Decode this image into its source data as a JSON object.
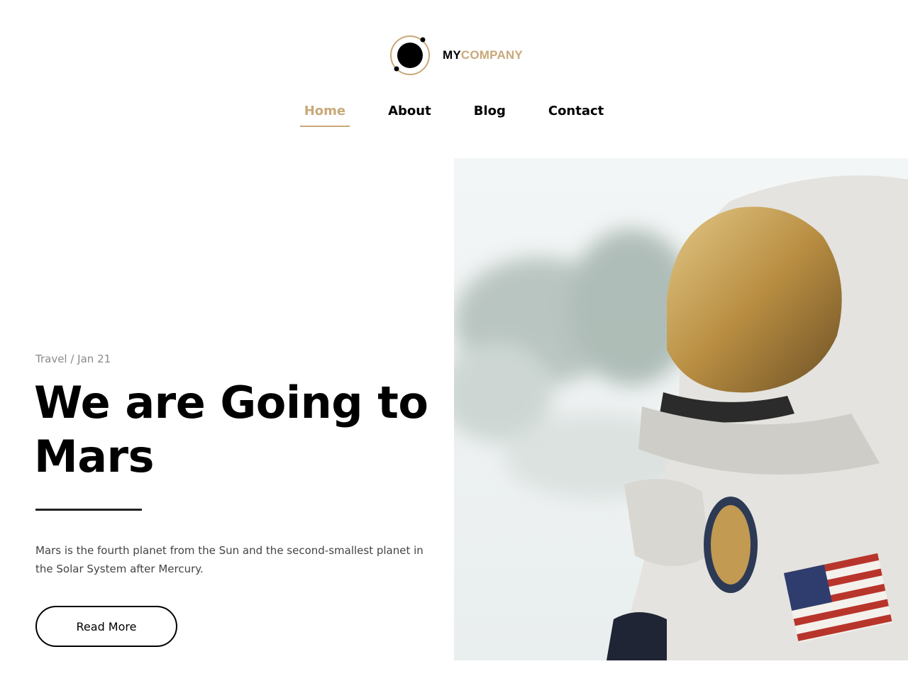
{
  "brand": {
    "name_part1": "MY",
    "name_part2": "COMPANY",
    "logo_icon": "planet-orbit-logo"
  },
  "nav": {
    "items": [
      {
        "label": "Home",
        "active": true
      },
      {
        "label": "About",
        "active": false
      },
      {
        "label": "Blog",
        "active": false
      },
      {
        "label": "Contact",
        "active": false
      }
    ]
  },
  "hero": {
    "meta": "Travel / Jan 21",
    "title_line1": "We are Going to",
    "title_line2": "Mars",
    "description": "Mars is the fourth planet from the Sun and the second-smallest planet in the Solar System after Mercury.",
    "button_label": "Read More",
    "image_subject": "astronaut-in-snow-photo"
  },
  "colors": {
    "accent": "#c8a97a",
    "text": "#000000",
    "muted": "#8a8a8a",
    "body": "#444444"
  }
}
